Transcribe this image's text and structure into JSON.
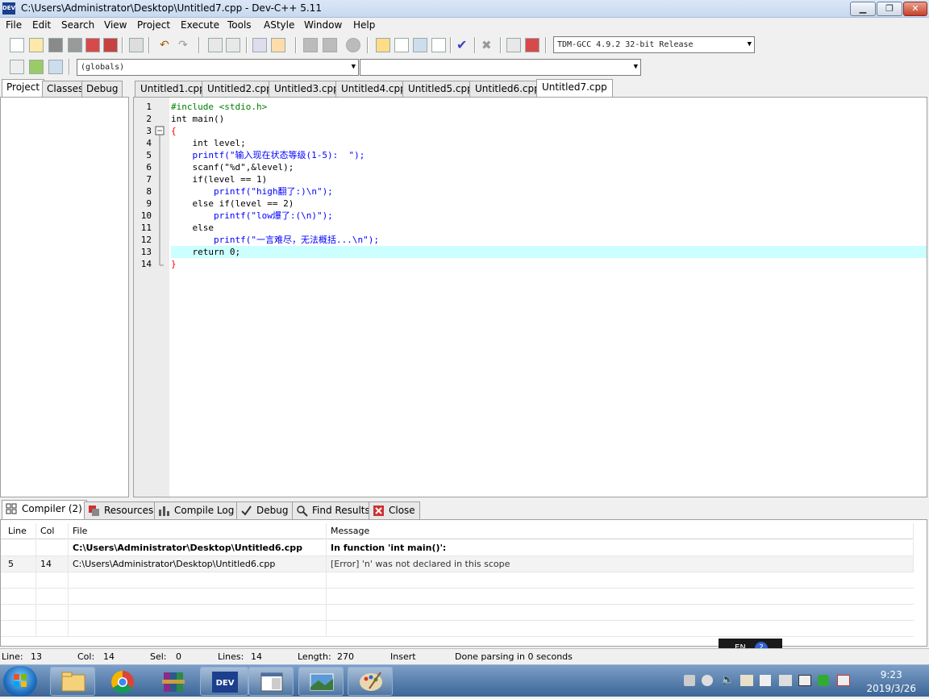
{
  "window": {
    "title": "C:\\Users\\Administrator\\Desktop\\Untitled7.cpp - Dev-C++ 5.11",
    "app_icon_text": "DEV",
    "minimize": "▁",
    "maximize": "❐",
    "close": "✕"
  },
  "menu": [
    "File",
    "Edit",
    "Search",
    "View",
    "Project",
    "Execute",
    "Tools",
    "AStyle",
    "Window",
    "Help"
  ],
  "toolbar": {
    "compiler_select": "TDM-GCC 4.9.2 32-bit Release",
    "scope_select": "(globals)",
    "function_select": ""
  },
  "left_tabs": [
    "Project",
    "Classes",
    "Debug"
  ],
  "editor_tabs": [
    "Untitled1.cpp",
    "Untitled2.cpp",
    "Untitled3.cpp",
    "Untitled4.cpp",
    "Untitled5.cpp",
    "Untitled6.cpp",
    "Untitled7.cpp"
  ],
  "active_editor_tab": "Untitled7.cpp",
  "code": {
    "line_numbers": [
      "1",
      "2",
      "3",
      "4",
      "5",
      "6",
      "7",
      "8",
      "9",
      "10",
      "11",
      "12",
      "13",
      "14"
    ],
    "lines": [
      "#include <stdio.h>",
      "int main()",
      "{",
      "    int level;",
      "    printf(\"输入现在状态等级(1-5):  \");",
      "    scanf(\"%d\",&level);",
      "    if(level == 1)",
      "        printf(\"high翻了:)\\n\");",
      "    else if(level == 2)",
      "        printf(\"low爆了:(\\n)\");",
      "    else",
      "        printf(\"一言难尽，无法概括...\\n\");",
      "    return 0;",
      "}"
    ],
    "highlighted_line": "13"
  },
  "bottom_tabs": [
    "Compiler (2)",
    "Resources",
    "Compile Log",
    "Debug",
    "Find Results",
    "Close"
  ],
  "messages": {
    "columns": [
      "Line",
      "Col",
      "File",
      "Message"
    ],
    "rows": [
      {
        "line": "",
        "col": "",
        "file": "C:\\Users\\Administrator\\Desktop\\Untitled6.cpp",
        "message": "In function 'int main()':",
        "bold": true
      },
      {
        "line": "5",
        "col": "14",
        "file": "C:\\Users\\Administrator\\Desktop\\Untitled6.cpp",
        "message": "[Error] 'n' was not declared in this scope",
        "bold": false
      }
    ]
  },
  "status": {
    "line_label": "Line:",
    "line": "13",
    "col_label": "Col:",
    "col": "14",
    "sel_label": "Sel:",
    "sel": "0",
    "lines_label": "Lines:",
    "lines": "14",
    "length_label": "Length:",
    "length": "270",
    "mode": "Insert",
    "parse": "Done parsing in 0 seconds"
  },
  "ime": {
    "lang": "EN",
    "help": "?"
  },
  "clock": {
    "time": "9:23",
    "date": "2019/3/26"
  }
}
